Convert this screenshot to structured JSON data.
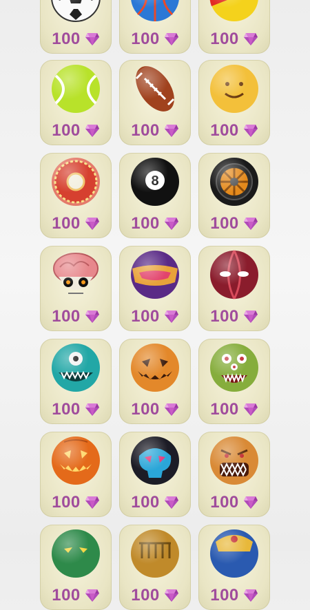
{
  "currency_icon": "purple-gem-icon",
  "price_color": "#a04c9c",
  "items": [
    {
      "name": "soccer-ball",
      "price": "100"
    },
    {
      "name": "basketball",
      "price": "100"
    },
    {
      "name": "beach-ball",
      "price": "100"
    },
    {
      "name": "tennis-ball",
      "price": "100"
    },
    {
      "name": "american-football",
      "price": "100"
    },
    {
      "name": "smiley-face-ball",
      "price": "100"
    },
    {
      "name": "donut-ball",
      "price": "100"
    },
    {
      "name": "eight-ball",
      "price": "100"
    },
    {
      "name": "tire-wheel-ball",
      "price": "100"
    },
    {
      "name": "brain-skull-ball",
      "price": "100"
    },
    {
      "name": "purple-visor-ball",
      "price": "100"
    },
    {
      "name": "red-glowing-eyes-ball",
      "price": "100"
    },
    {
      "name": "teal-cyclops-monster-ball",
      "price": "100"
    },
    {
      "name": "orange-jack-o-lantern-ball",
      "price": "100"
    },
    {
      "name": "green-multi-eye-monster-ball",
      "price": "100"
    },
    {
      "name": "carved-pumpkin-ball",
      "price": "100"
    },
    {
      "name": "blue-skull-ball",
      "price": "100"
    },
    {
      "name": "angry-orange-monster-ball",
      "price": "100"
    },
    {
      "name": "green-lizard-ball",
      "price": "100"
    },
    {
      "name": "gold-temple-ball",
      "price": "100"
    },
    {
      "name": "pharaoh-ball",
      "price": "100"
    }
  ]
}
